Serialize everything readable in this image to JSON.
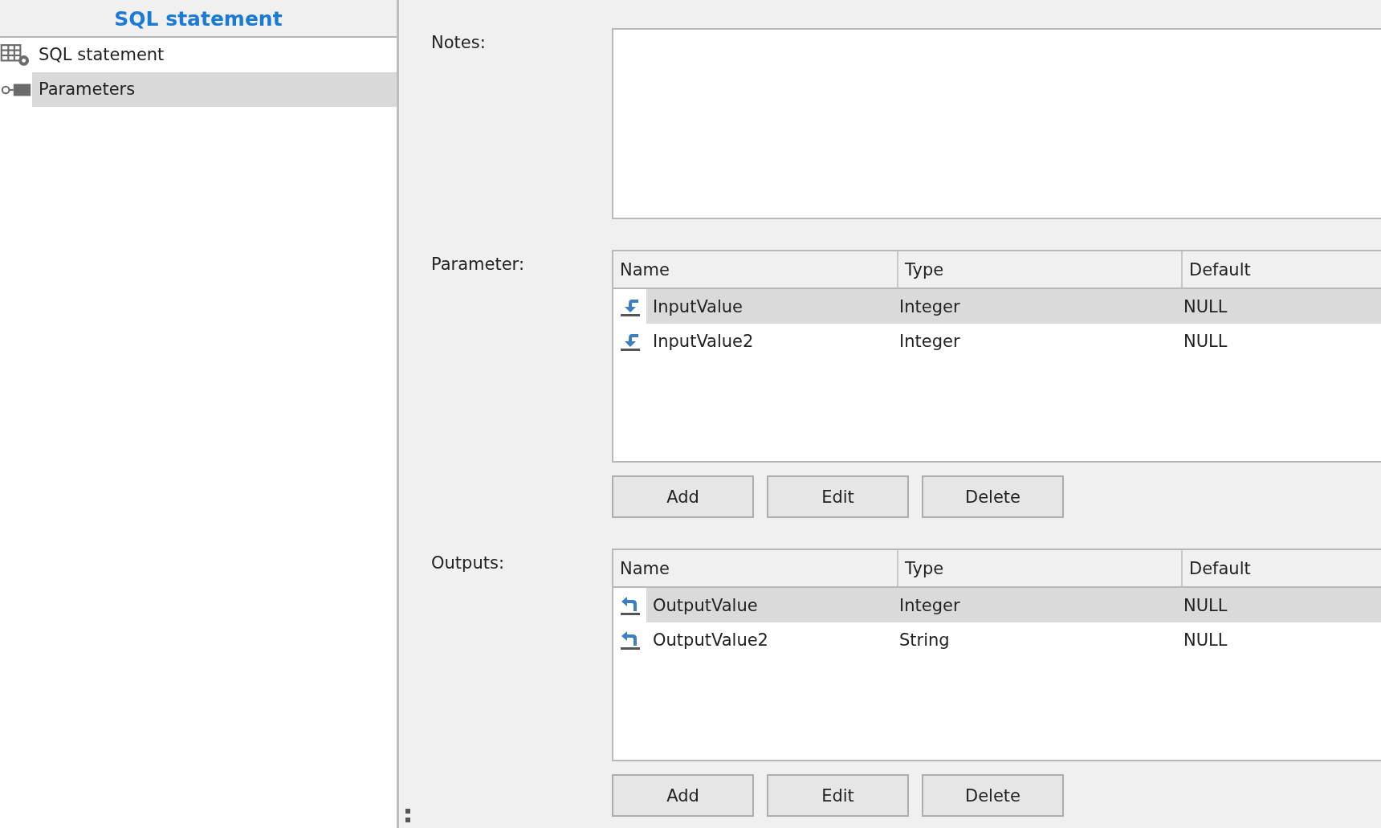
{
  "sidebar": {
    "title": "SQL statement",
    "items": [
      {
        "label": "SQL statement",
        "kind": "statement",
        "selected": false
      },
      {
        "label": "Parameters",
        "kind": "parameter",
        "selected": true
      }
    ]
  },
  "notes": {
    "label": "Notes:"
  },
  "parameters": {
    "label": "Parameter:",
    "columns": [
      "Name",
      "Type",
      "Default"
    ],
    "rows": [
      {
        "name": "InputValue",
        "type": "Integer",
        "default": "NULL",
        "selected": true
      },
      {
        "name": "InputValue2",
        "type": "Integer",
        "default": "NULL",
        "selected": false
      }
    ],
    "buttons": [
      "Add",
      "Edit",
      "Delete"
    ]
  },
  "outputs": {
    "label": "Outputs:",
    "columns": [
      "Name",
      "Type",
      "Default"
    ],
    "rows": [
      {
        "name": "OutputValue",
        "type": "Integer",
        "default": "NULL",
        "selected": true
      },
      {
        "name": "OutputValue2",
        "type": "String",
        "default": "NULL",
        "selected": false
      }
    ],
    "buttons": [
      "Add",
      "Edit",
      "Delete"
    ]
  }
}
